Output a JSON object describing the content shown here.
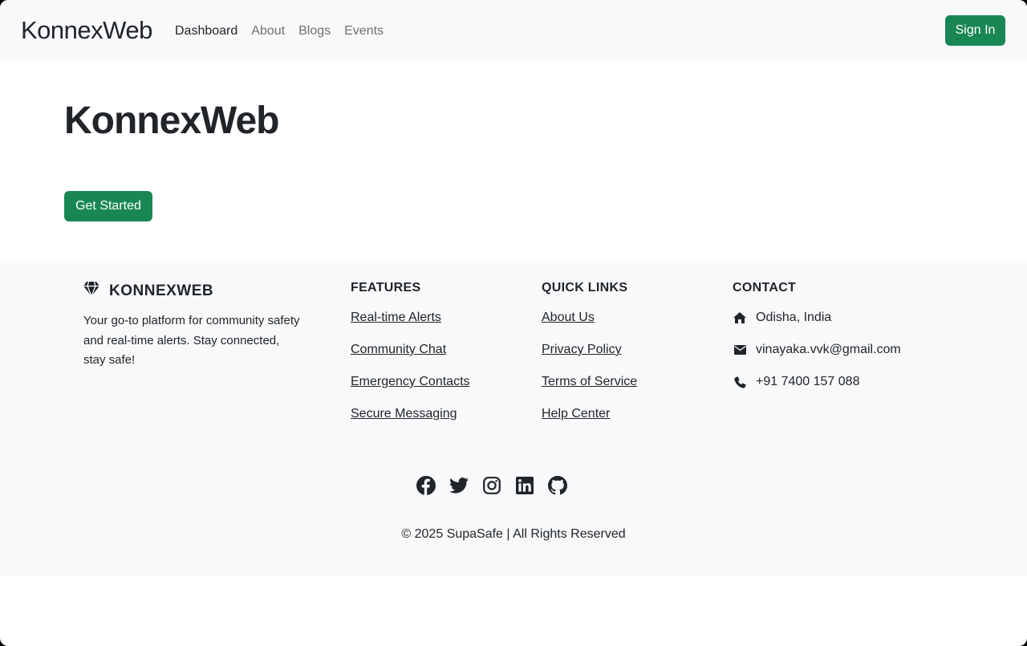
{
  "navbar": {
    "brand": "KonnexWeb",
    "links": [
      {
        "label": "Dashboard",
        "active": true
      },
      {
        "label": "About",
        "active": false
      },
      {
        "label": "Blogs",
        "active": false
      },
      {
        "label": "Events",
        "active": false
      }
    ],
    "signin_label": "Sign In"
  },
  "hero": {
    "title": "KonnexWeb",
    "cta_label": "Get Started"
  },
  "footer": {
    "brand_icon": "gem-icon",
    "brand_name": "KONNEXWEB",
    "description": "Your go-to platform for community safety and real-time alerts. Stay connected, stay safe!",
    "features": {
      "heading": "FEATURES",
      "links": [
        "Real-time Alerts",
        "Community Chat",
        "Emergency Contacts",
        "Secure Messaging"
      ]
    },
    "quick_links": {
      "heading": "QUICK LINKS",
      "links": [
        "About Us",
        "Privacy Policy",
        "Terms of Service",
        "Help Center"
      ]
    },
    "contact": {
      "heading": "CONTACT",
      "items": [
        {
          "icon": "home-icon",
          "text": "Odisha, India"
        },
        {
          "icon": "envelope-icon",
          "text": "vinayaka.vvk@gmail.com"
        },
        {
          "icon": "phone-icon",
          "text": "+91 7400 157 088"
        }
      ]
    },
    "socials": [
      "facebook-icon",
      "twitter-icon",
      "instagram-icon",
      "linkedin-icon",
      "github-icon"
    ],
    "copyright": "© 2025 SupaSafe | All Rights Reserved"
  },
  "colors": {
    "primary_green": "#198754",
    "light_bg": "#f8f9fa",
    "text_dark": "#212529"
  }
}
